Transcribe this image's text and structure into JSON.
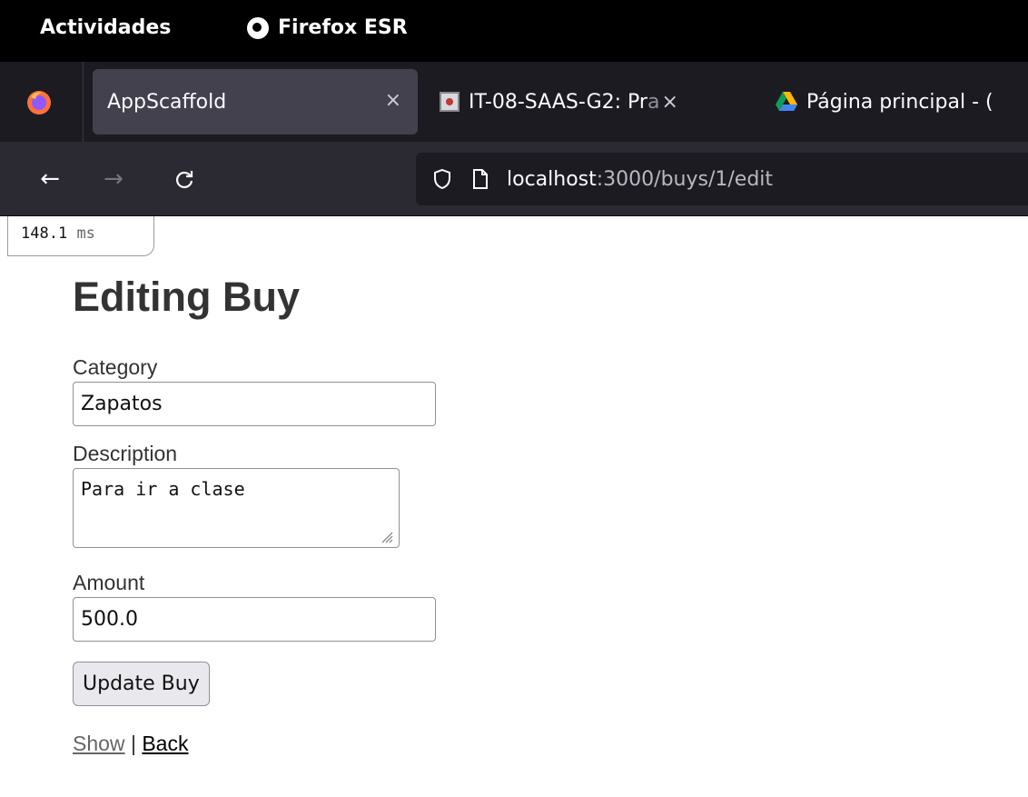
{
  "system_bar": {
    "activities": "Actividades",
    "app_name": "Firefox ESR"
  },
  "tabs": [
    {
      "title": "AppScaffold",
      "close": "×",
      "active": true
    },
    {
      "title": "IT-08-SAAS-G2: Pr",
      "title_fade": "a",
      "close": "×",
      "active": false
    },
    {
      "title": "Página principal - (",
      "active": false
    }
  ],
  "nav": {
    "back_glyph": "←",
    "forward_glyph": "→",
    "reload_glyph": "C",
    "url_host": "localhost",
    "url_rest": ":3000/buys/1/edit"
  },
  "profiler": {
    "value": "148.1",
    "unit": "ms"
  },
  "page": {
    "heading": "Editing Buy",
    "category_label": "Category",
    "category_value": "Zapatos",
    "description_label": "Description",
    "description_value": "Para ir a clase",
    "amount_label": "Amount",
    "amount_value": "500.0",
    "submit_label": "Update Buy",
    "show_link": "Show",
    "separator": "|",
    "back_link": "Back"
  },
  "colors": {
    "topbar": "#000000",
    "tabstrip": "#1c1b22",
    "active_tab": "#42414d",
    "navbar": "#2b2a33",
    "text": "#333333"
  }
}
